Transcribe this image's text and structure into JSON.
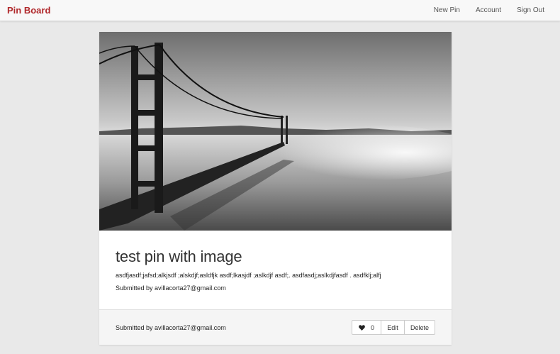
{
  "navbar": {
    "brand": "Pin Board",
    "links": [
      "New Pin",
      "Account",
      "Sign Out"
    ]
  },
  "pin": {
    "image_alt": "bridge-photo",
    "title": "test pin with image",
    "description": "asdfjasdf;jafsd;alkjsdf ;alskdjf;asldfjk asdf;lkasjdf ;aslkdjf asdf;. asdfasdj;aslkdjfasdf . asdfklj;alfj",
    "submitted_by": "Submitted by avillacorta27@gmail.com"
  },
  "footer": {
    "submitted_by": "Submitted by avillacorta27@gmail.com",
    "like_count": "0",
    "edit_label": "Edit",
    "delete_label": "Delete",
    "like_icon": "heart-icon"
  },
  "colors": {
    "brand": "#b0282b",
    "page_bg": "#e9e9e9"
  }
}
